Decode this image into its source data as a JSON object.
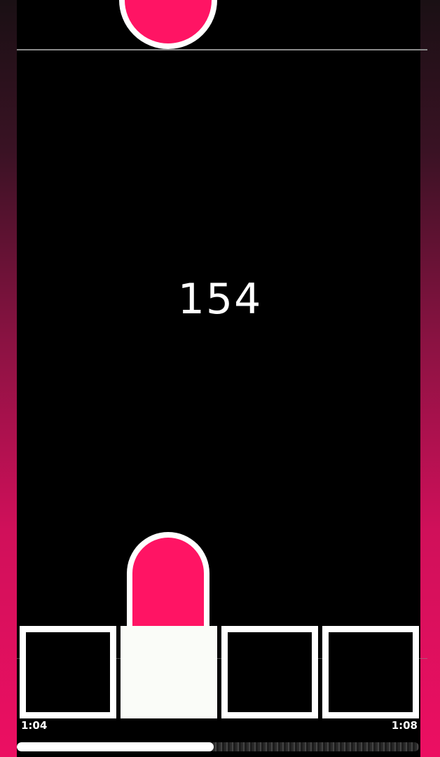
{
  "game": {
    "score": "154",
    "active_lane": 2,
    "lane_count": 4
  },
  "playback": {
    "current_time": "1:04",
    "total_time": "1:08",
    "progress_fraction": 0.49
  },
  "colors": {
    "note": "#ff1464",
    "outline": "#ffffff",
    "background": "#000000",
    "side_gradient_top": "#1a1014",
    "side_gradient_bottom": "#ec0f62"
  },
  "icons": {
    "falling_note": "pink-rounded-note",
    "player_piece": "pink-dome-piece"
  }
}
